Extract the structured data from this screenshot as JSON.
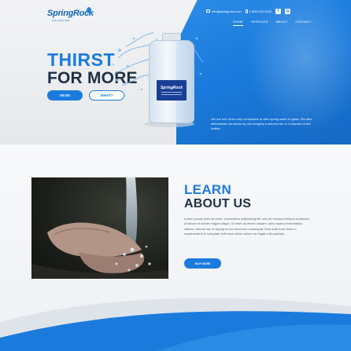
{
  "brand": {
    "name": "SpringRock",
    "tagline": "pure spring water"
  },
  "contact": {
    "email": "info@springrock.com",
    "phone": "1-800-000-0400"
  },
  "social": [
    {
      "icon": "facebook-icon",
      "glyph": "f"
    },
    {
      "icon": "instagram-icon",
      "glyph": "◎"
    }
  ],
  "nav": [
    {
      "label": "HOME",
      "active": true
    },
    {
      "label": "SERVICES",
      "active": false
    },
    {
      "label": "ABOUT",
      "active": false
    },
    {
      "label": "CONTACT",
      "active": false
    }
  ],
  "hero": {
    "title_line1": "THIRST",
    "title_line2": "FOR MORE",
    "primary_button": "I'M IN!",
    "secondary_button": "WHAT?",
    "bottle_label": "SpringRock",
    "description": "We are one of the only companies to offer spring water in glass. We also differentiate ourselves by not charging a delivery fee or a deposit on the bottles."
  },
  "about": {
    "title_line1": "LEARN",
    "title_line2": "ABOUT US",
    "text": "Lorem ipsum dolor sit amet, consectetur adipisicing elit, sed do eiusmod tempor incididunt ut labore et dolore magna aliqua. Ut enim ad minim veniam, quis nostrud exercitation ullamco laboris nisi ut aliquip ex ea commodo consequat. Duis aute irure dolor in reprehenderit in voluptate velit esse cillum dolore eu fugiat nulla pariatur.",
    "button": "BUY NOW"
  },
  "colors": {
    "brand_blue": "#1a7bdd",
    "navy": "#1f2f44",
    "label_blue": "#1a3f96"
  }
}
